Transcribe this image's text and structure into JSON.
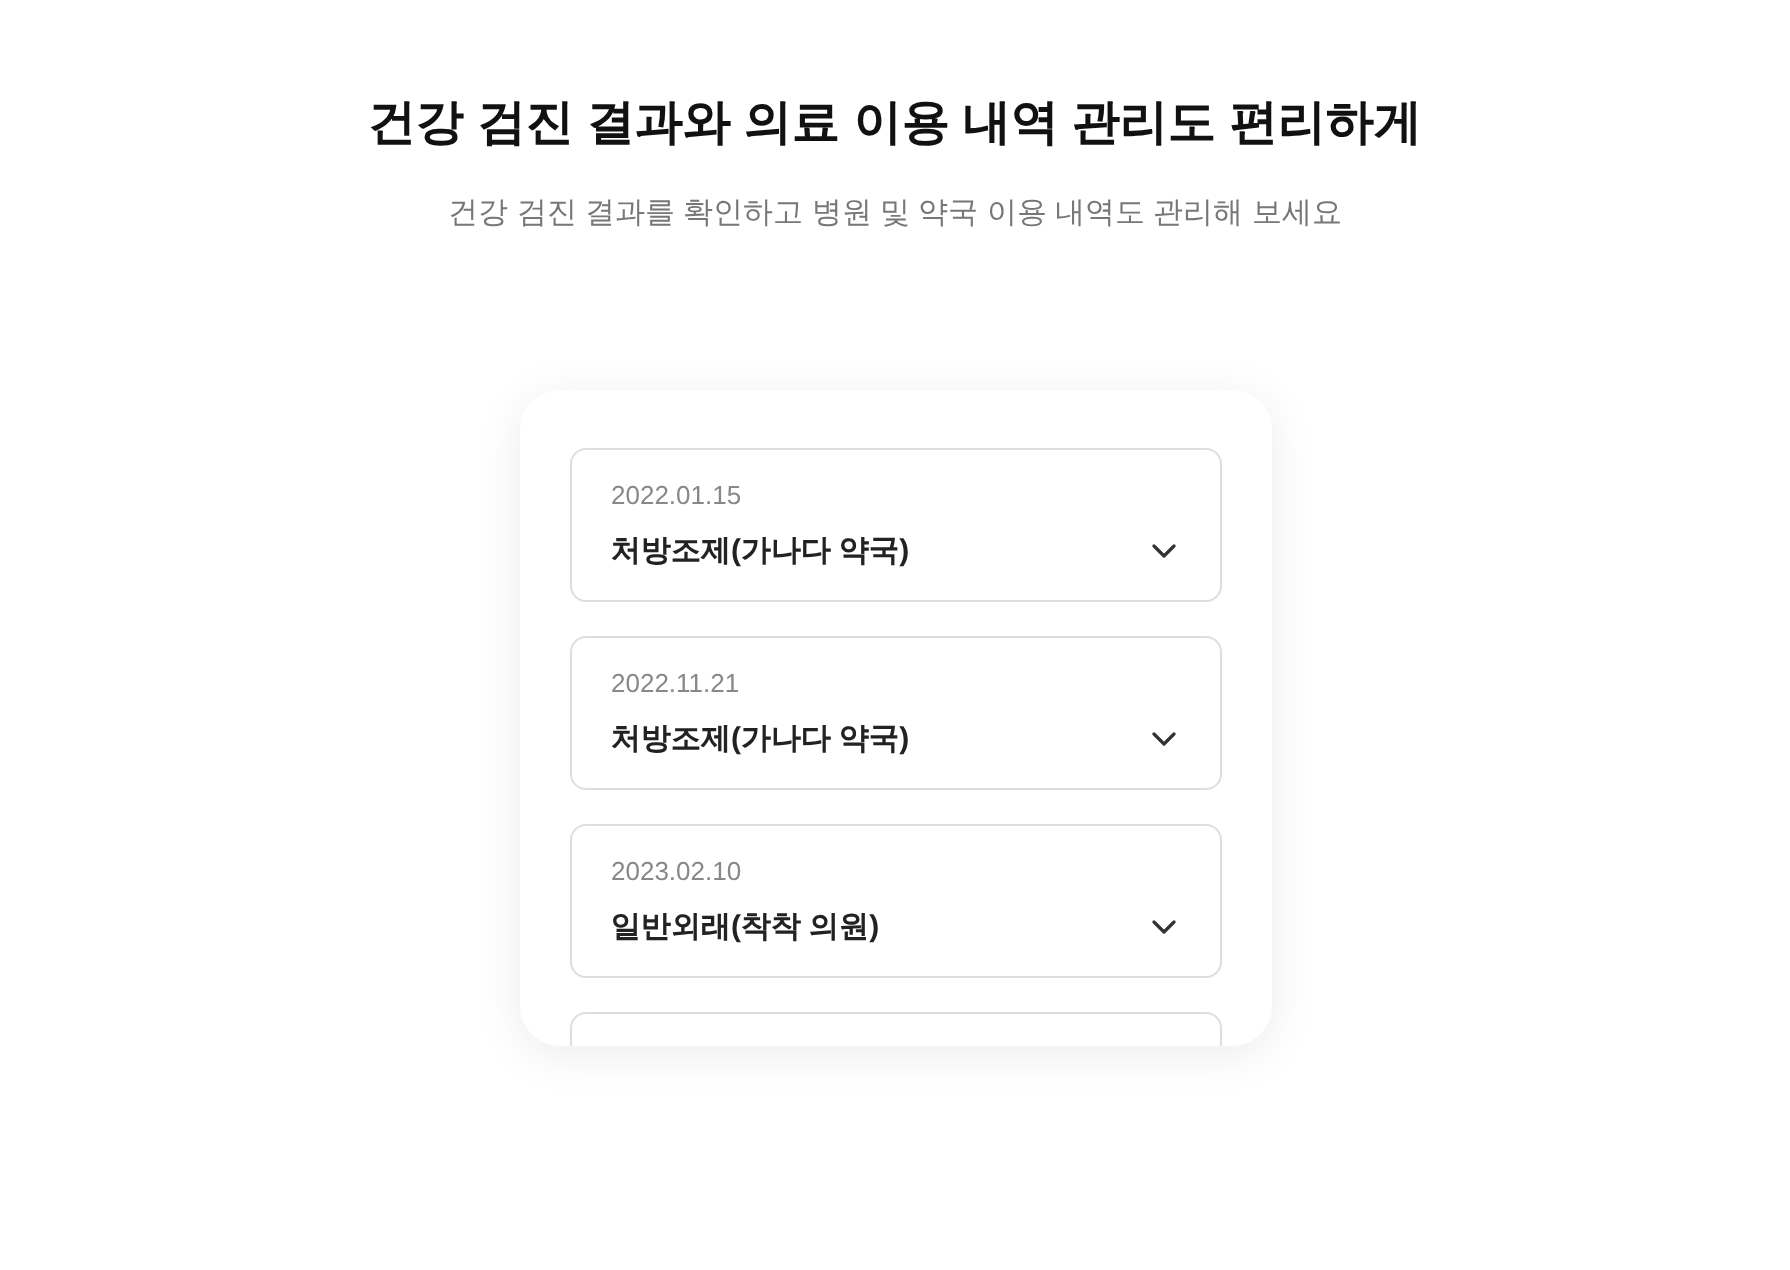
{
  "header": {
    "title": "건강 검진 결과와 의료 이용 내역 관리도 편리하게",
    "subtitle": "건강 검진 결과를 확인하고 병원 및 약국 이용 내역도 관리해 보세요"
  },
  "records": [
    {
      "date": "2022.01.15",
      "title": "처방조제(가나다 약국)",
      "expanded": false
    },
    {
      "date": "2022.11.21",
      "title": "처방조제(가나다 약국)",
      "expanded": false
    },
    {
      "date": "2023.02.10",
      "title": "일반외래(착착 의원)",
      "expanded": false
    }
  ],
  "more_records_below": true
}
